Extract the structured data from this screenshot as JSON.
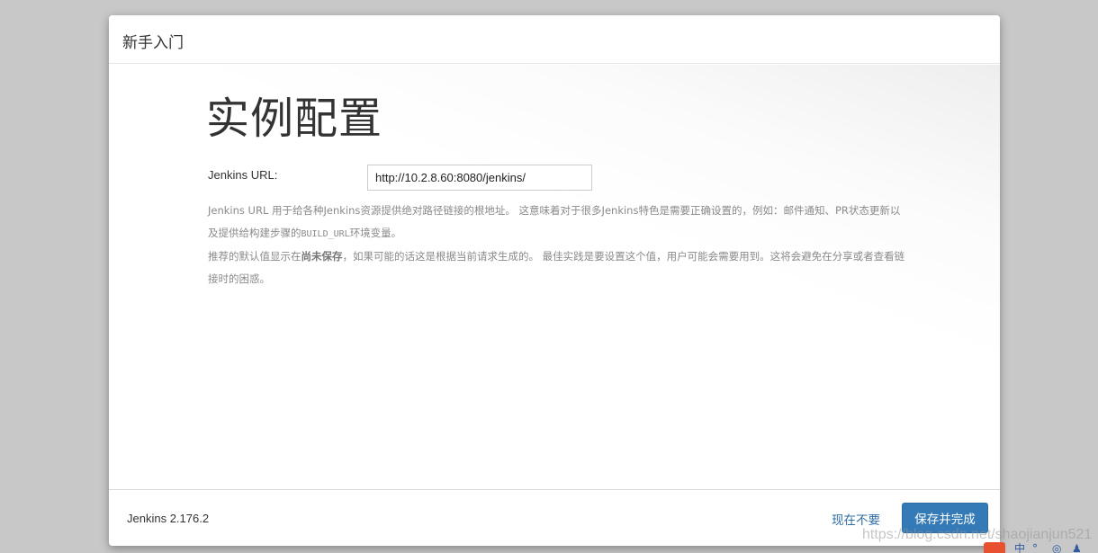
{
  "dialog": {
    "title": "新手入门"
  },
  "body": {
    "heading": "实例配置",
    "url_field": {
      "label": "Jenkins URL:",
      "value": "http://10.2.8.60:8080/jenkins/"
    },
    "help": {
      "p1_part1": "Jenkins URL 用于给各种Jenkins资源提供绝对路径链接的根地址。 这意味着对于很多Jenkins特色是需要正确设置的，例如：邮件通知、PR状态更新以及提供给构建步骤的",
      "p1_code": "BUILD_URL",
      "p1_part2": "环境变量。",
      "p2_part1": "推荐的默认值显示在",
      "p2_strong": "尚未保存",
      "p2_part2": "，如果可能的话这是根据当前请求生成的。 最佳实践是要设置这个值，用户可能会需要用到。这将会避免在分享或者查看链接时的困惑。"
    }
  },
  "footer": {
    "version": "Jenkins 2.176.2",
    "skip_label": "现在不要",
    "save_label": "保存并完成"
  },
  "watermark": "https://blog.csdn.net/shaojianjun521",
  "tray": {
    "ime_label": "中",
    "icons": [
      "csdn-logo-icon",
      "ime-icon",
      "punctuation-icon",
      "settings-icon",
      "user-icon"
    ]
  },
  "colors": {
    "primary": "#337ab7",
    "link": "#2e6da4",
    "help_text": "#8a8a8a",
    "backdrop": "#c8c8c8"
  }
}
